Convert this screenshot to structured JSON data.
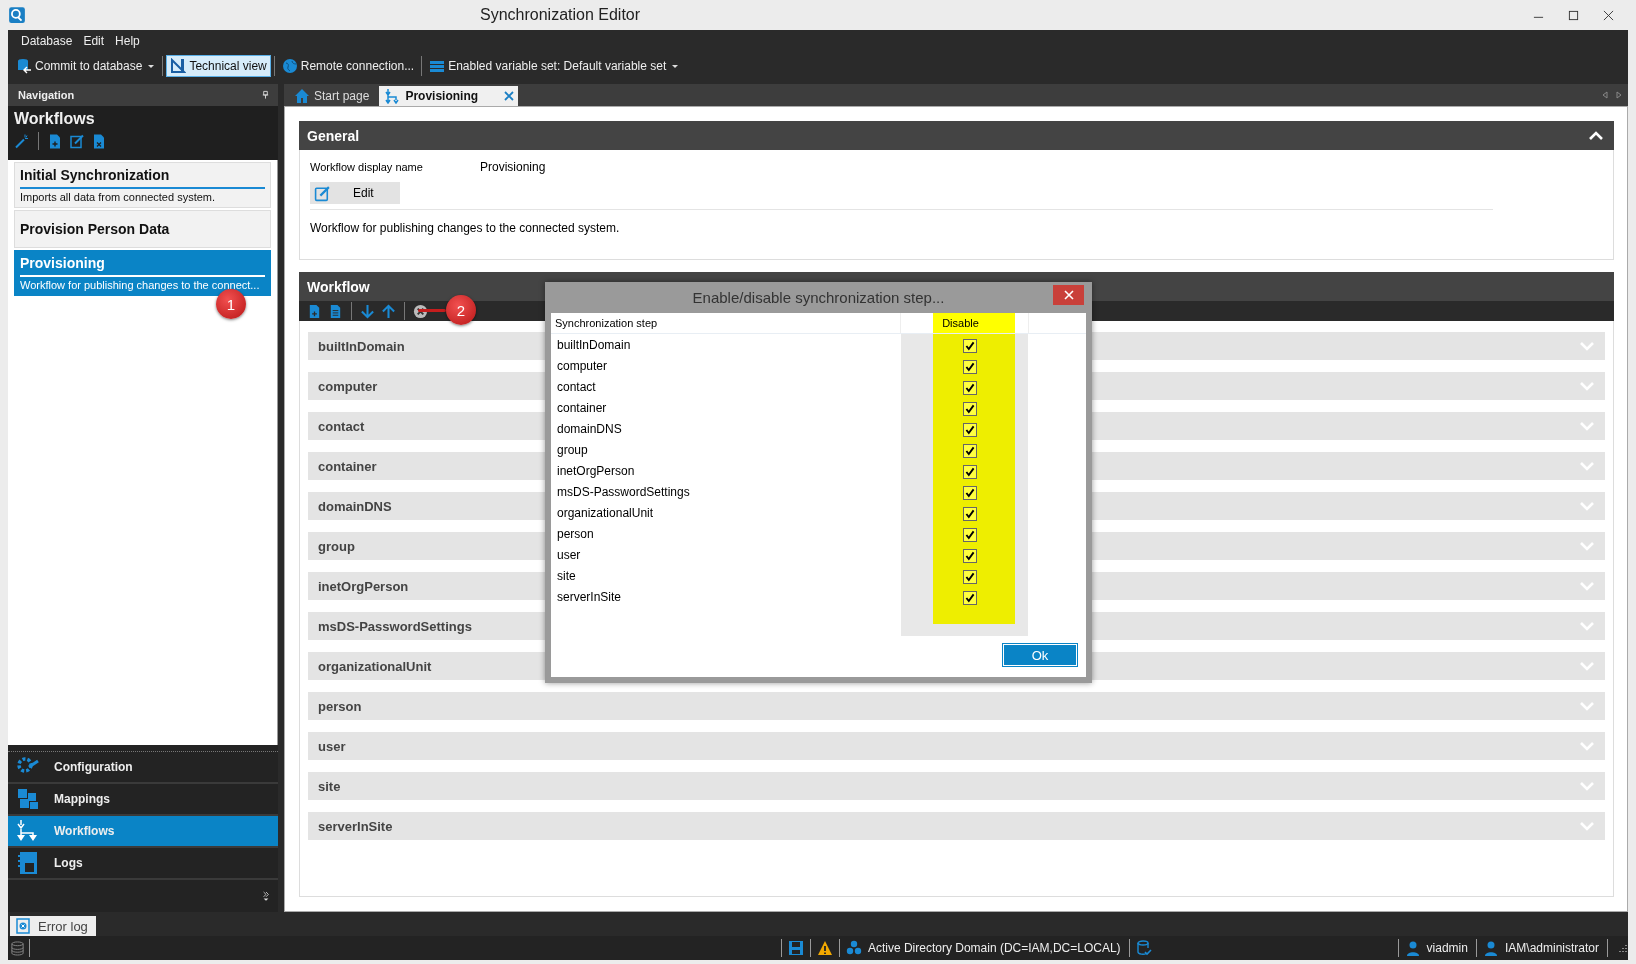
{
  "window": {
    "title": "Synchronization Editor"
  },
  "menu": [
    "Database",
    "Edit",
    "Help"
  ],
  "toolbar": [
    {
      "label": "Commit to database",
      "dropdown": true,
      "pressed": false
    },
    {
      "label": "Technical view",
      "dropdown": false,
      "pressed": true
    },
    {
      "label": "Remote connection...",
      "dropdown": false,
      "pressed": false
    },
    {
      "label": "Enabled variable set: Default variable set",
      "dropdown": true,
      "pressed": false
    }
  ],
  "navigation": {
    "title": "Navigation",
    "section": "Workflows",
    "items": [
      {
        "title": "Initial Synchronization",
        "description": "Imports all data from connected system.",
        "selected": false
      },
      {
        "title": "Provision Person Data",
        "selected": false
      },
      {
        "title": "Provisioning",
        "description": "Workflow for publishing changes to the connect...",
        "selected": true
      }
    ],
    "modules": [
      {
        "label": "Configuration",
        "selected": false
      },
      {
        "label": "Mappings",
        "selected": false
      },
      {
        "label": "Workflows",
        "selected": true
      },
      {
        "label": "Logs",
        "selected": false
      }
    ]
  },
  "tabs": [
    {
      "label": "Start page",
      "selected": false,
      "closable": false
    },
    {
      "label": "Provisioning",
      "selected": true,
      "closable": true
    }
  ],
  "general": {
    "title": "General",
    "field_label": "Workflow display name",
    "field_value": "Provisioning",
    "edit_button": "Edit",
    "description": "Workflow for publishing changes to the connected system."
  },
  "workflow": {
    "title": "Workflow",
    "steps": [
      "builtInDomain",
      "computer",
      "contact",
      "container",
      "domainDNS",
      "group",
      "inetOrgPerson",
      "msDS-PasswordSettings",
      "organizationalUnit",
      "person",
      "user",
      "site",
      "serverInSite"
    ]
  },
  "dialog": {
    "title": "Enable/disable synchronization step...",
    "columns": [
      "Synchronization step",
      "Disable"
    ],
    "rows": [
      {
        "name": "builtInDomain",
        "checked": true
      },
      {
        "name": "computer",
        "checked": true
      },
      {
        "name": "contact",
        "checked": true
      },
      {
        "name": "container",
        "checked": true
      },
      {
        "name": "domainDNS",
        "checked": true
      },
      {
        "name": "group",
        "checked": true
      },
      {
        "name": "inetOrgPerson",
        "checked": true
      },
      {
        "name": "msDS-PasswordSettings",
        "checked": true
      },
      {
        "name": "organizationalUnit",
        "checked": true
      },
      {
        "name": "person",
        "checked": true
      },
      {
        "name": "user",
        "checked": true
      },
      {
        "name": "site",
        "checked": true
      },
      {
        "name": "serverInSite",
        "checked": true
      }
    ],
    "ok_button": "Ok"
  },
  "callouts": [
    "1",
    "2"
  ],
  "error_log": "Error log",
  "status_bar": {
    "connection": "Active Directory Domain (DC=IAM,DC=LOCAL)",
    "users": [
      "viadmin",
      "IAM\\administrator"
    ]
  }
}
